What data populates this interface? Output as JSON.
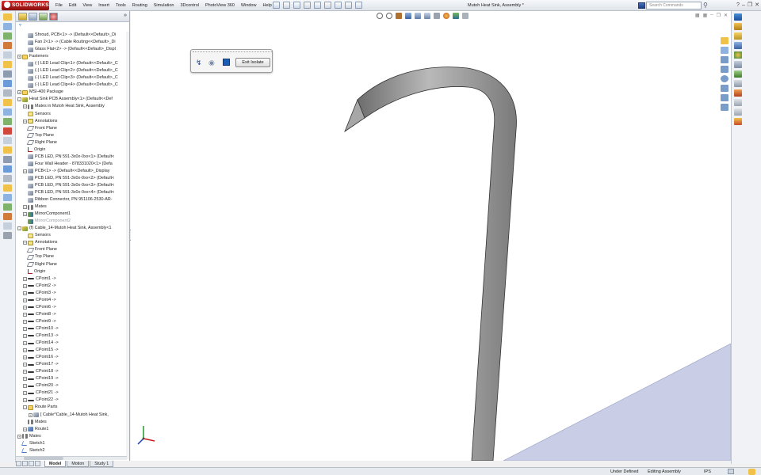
{
  "app": {
    "logo_text": "SOLIDWORKS",
    "menus": [
      "File",
      "Edit",
      "View",
      "Insert",
      "Tools",
      "Routing",
      "Simulation",
      "3Dcontrol",
      "PhotoView 360",
      "Window",
      "Help"
    ],
    "document_title": "Mutoh Heat Sink, Assembly *",
    "search_placeholder": "Search Commands"
  },
  "feature_tree": {
    "filter_icon": "funnel-icon",
    "nodes": [
      {
        "label": "Shroud, PCB<1> -> (Default<<Default>_Di",
        "icon": "part",
        "indent": 1,
        "toggle": "none"
      },
      {
        "label": "Fan 2<1> -> (Cable Routing<<Default>_Di",
        "icon": "part",
        "indent": 1,
        "toggle": "none"
      },
      {
        "label": "Glass Flat<2> -> (Default<<Default>_Displ",
        "icon": "part",
        "indent": 1,
        "toggle": "none"
      },
      {
        "label": "Fasteners",
        "icon": "folder",
        "indent": 0,
        "toggle": "+"
      },
      {
        "label": "(-) LED Lead Clip<1> (Default<<Default>_C",
        "icon": "part",
        "indent": 1,
        "toggle": "none"
      },
      {
        "label": "(-) LED Lead Clip<2> (Default<<Default>_C",
        "icon": "part",
        "indent": 1,
        "toggle": "none"
      },
      {
        "label": "(-) LED Lead Clip<3> (Default<<Default>_C",
        "icon": "part",
        "indent": 1,
        "toggle": "none"
      },
      {
        "label": "(-) LED Lead Clip<4> (Default<<Default>_C",
        "icon": "part",
        "indent": 1,
        "toggle": "none"
      },
      {
        "label": "MSI-400 Package",
        "icon": "folder",
        "indent": 0,
        "toggle": "+"
      },
      {
        "label": "Heat Sink PCB Assembly<1> (Default<<Def",
        "icon": "asm",
        "indent": 0,
        "toggle": "-"
      },
      {
        "label": "Mates in Mutoh Heat Sink, Assembly",
        "icon": "mates",
        "indent": 1,
        "toggle": "+"
      },
      {
        "label": "Sensors",
        "icon": "sensor",
        "indent": 1,
        "toggle": "none"
      },
      {
        "label": "Annotations",
        "icon": "annot",
        "indent": 1,
        "toggle": "+"
      },
      {
        "label": "Front Plane",
        "icon": "plane",
        "indent": 1,
        "toggle": "none"
      },
      {
        "label": "Top Plane",
        "icon": "plane",
        "indent": 1,
        "toggle": "none"
      },
      {
        "label": "Right Plane",
        "icon": "plane",
        "indent": 1,
        "toggle": "none"
      },
      {
        "label": "Origin",
        "icon": "origin",
        "indent": 1,
        "toggle": "none"
      },
      {
        "label": "PCB LED, PN 591-3x0x-0xx<1> (Default<",
        "icon": "part",
        "indent": 1,
        "toggle": "none"
      },
      {
        "label": "Four Wall Header - 878331020<1> (Defa",
        "icon": "part",
        "indent": 1,
        "toggle": "none"
      },
      {
        "label": "PCB<1> -> (Default<<Default>_Display",
        "icon": "part",
        "indent": 1,
        "toggle": "+"
      },
      {
        "label": "PCB LED, PN 591-3x0x-0xx<2> (Default<",
        "icon": "part",
        "indent": 1,
        "toggle": "none"
      },
      {
        "label": "PCB LED, PN 591-3x0x-0xx<3> (Default<",
        "icon": "part",
        "indent": 1,
        "toggle": "none"
      },
      {
        "label": "PCB LED, PN 591-3x0x-0xx<4> (Default<",
        "icon": "part",
        "indent": 1,
        "toggle": "none"
      },
      {
        "label": "Ribbon Connector, PN 951106-2530-AR-",
        "icon": "part",
        "indent": 1,
        "toggle": "none"
      },
      {
        "label": "Mates",
        "icon": "mates",
        "indent": 1,
        "toggle": "+"
      },
      {
        "label": "MirrorComponent1",
        "icon": "mirror",
        "indent": 1,
        "toggle": "+"
      },
      {
        "label": "MirrorComponent2",
        "icon": "mirror",
        "indent": 1,
        "toggle": "none",
        "grey": true
      },
      {
        "label": "(f) Cable_14-Mutoh Heat Sink, Assembly<1",
        "icon": "asm",
        "indent": 0,
        "toggle": "-"
      },
      {
        "label": "Sensors",
        "icon": "sensor",
        "indent": 1,
        "toggle": "none"
      },
      {
        "label": "Annotations",
        "icon": "annot",
        "indent": 1,
        "toggle": "+"
      },
      {
        "label": "Front Plane",
        "icon": "plane",
        "indent": 1,
        "toggle": "none"
      },
      {
        "label": "Top Plane",
        "icon": "plane",
        "indent": 1,
        "toggle": "none"
      },
      {
        "label": "Right Plane",
        "icon": "plane",
        "indent": 1,
        "toggle": "none"
      },
      {
        "label": "Origin",
        "icon": "origin",
        "indent": 1,
        "toggle": "none"
      },
      {
        "label": "CPoint1 ->",
        "icon": "cpoint",
        "indent": 1,
        "toggle": "+"
      },
      {
        "label": "CPoint2 ->",
        "icon": "cpoint",
        "indent": 1,
        "toggle": "+"
      },
      {
        "label": "CPoint3 ->",
        "icon": "cpoint",
        "indent": 1,
        "toggle": "+"
      },
      {
        "label": "CPoint4 ->",
        "icon": "cpoint",
        "indent": 1,
        "toggle": "+"
      },
      {
        "label": "CPoint6 ->",
        "icon": "cpoint",
        "indent": 1,
        "toggle": "+"
      },
      {
        "label": "CPoint8 ->",
        "icon": "cpoint",
        "indent": 1,
        "toggle": "+"
      },
      {
        "label": "CPoint9 ->",
        "icon": "cpoint",
        "indent": 1,
        "toggle": "+"
      },
      {
        "label": "CPoint10 ->",
        "icon": "cpoint",
        "indent": 1,
        "toggle": "+"
      },
      {
        "label": "CPoint13 ->",
        "icon": "cpoint",
        "indent": 1,
        "toggle": "+"
      },
      {
        "label": "CPoint14 ->",
        "icon": "cpoint",
        "indent": 1,
        "toggle": "+"
      },
      {
        "label": "CPoint15 ->",
        "icon": "cpoint",
        "indent": 1,
        "toggle": "+"
      },
      {
        "label": "CPoint16 ->",
        "icon": "cpoint",
        "indent": 1,
        "toggle": "+"
      },
      {
        "label": "CPoint17 ->",
        "icon": "cpoint",
        "indent": 1,
        "toggle": "+"
      },
      {
        "label": "CPoint18 ->",
        "icon": "cpoint",
        "indent": 1,
        "toggle": "+"
      },
      {
        "label": "CPoint19 ->",
        "icon": "cpoint",
        "indent": 1,
        "toggle": "+"
      },
      {
        "label": "CPoint20 ->",
        "icon": "cpoint",
        "indent": 1,
        "toggle": "+"
      },
      {
        "label": "CPoint21 ->",
        "icon": "cpoint",
        "indent": 1,
        "toggle": "+"
      },
      {
        "label": "CPoint22 ->",
        "icon": "cpoint",
        "indent": 1,
        "toggle": "+"
      },
      {
        "label": "Route Parts",
        "icon": "folder",
        "indent": 1,
        "toggle": "-"
      },
      {
        "label": "[ Cable^Cable_14-Mutoh Heat Sink,",
        "icon": "part",
        "indent": 2,
        "toggle": "+"
      },
      {
        "label": "Mates",
        "icon": "mates",
        "indent": 1,
        "toggle": "none"
      },
      {
        "label": "Route1",
        "icon": "route",
        "indent": 1,
        "toggle": "+"
      },
      {
        "label": "Mates",
        "icon": "mates",
        "indent": 0,
        "toggle": "+"
      },
      {
        "label": "Sketch1",
        "icon": "sketch",
        "indent": 0,
        "toggle": "none"
      },
      {
        "label": "Sketch2",
        "icon": "sketch",
        "indent": 0,
        "toggle": "none"
      }
    ]
  },
  "isolate_toolbar": {
    "exit_label": "Exit Isolate"
  },
  "bottom_tabs": [
    "Model",
    "Motion",
    "Study 1"
  ],
  "status_bar": {
    "definition": "Under Defined",
    "mode": "Editing Assembly",
    "units": "IPS"
  },
  "colors": {
    "model_gray": "#8c8c8c",
    "floor_plane": "#c9cee6",
    "accent": "#c81e1e"
  }
}
